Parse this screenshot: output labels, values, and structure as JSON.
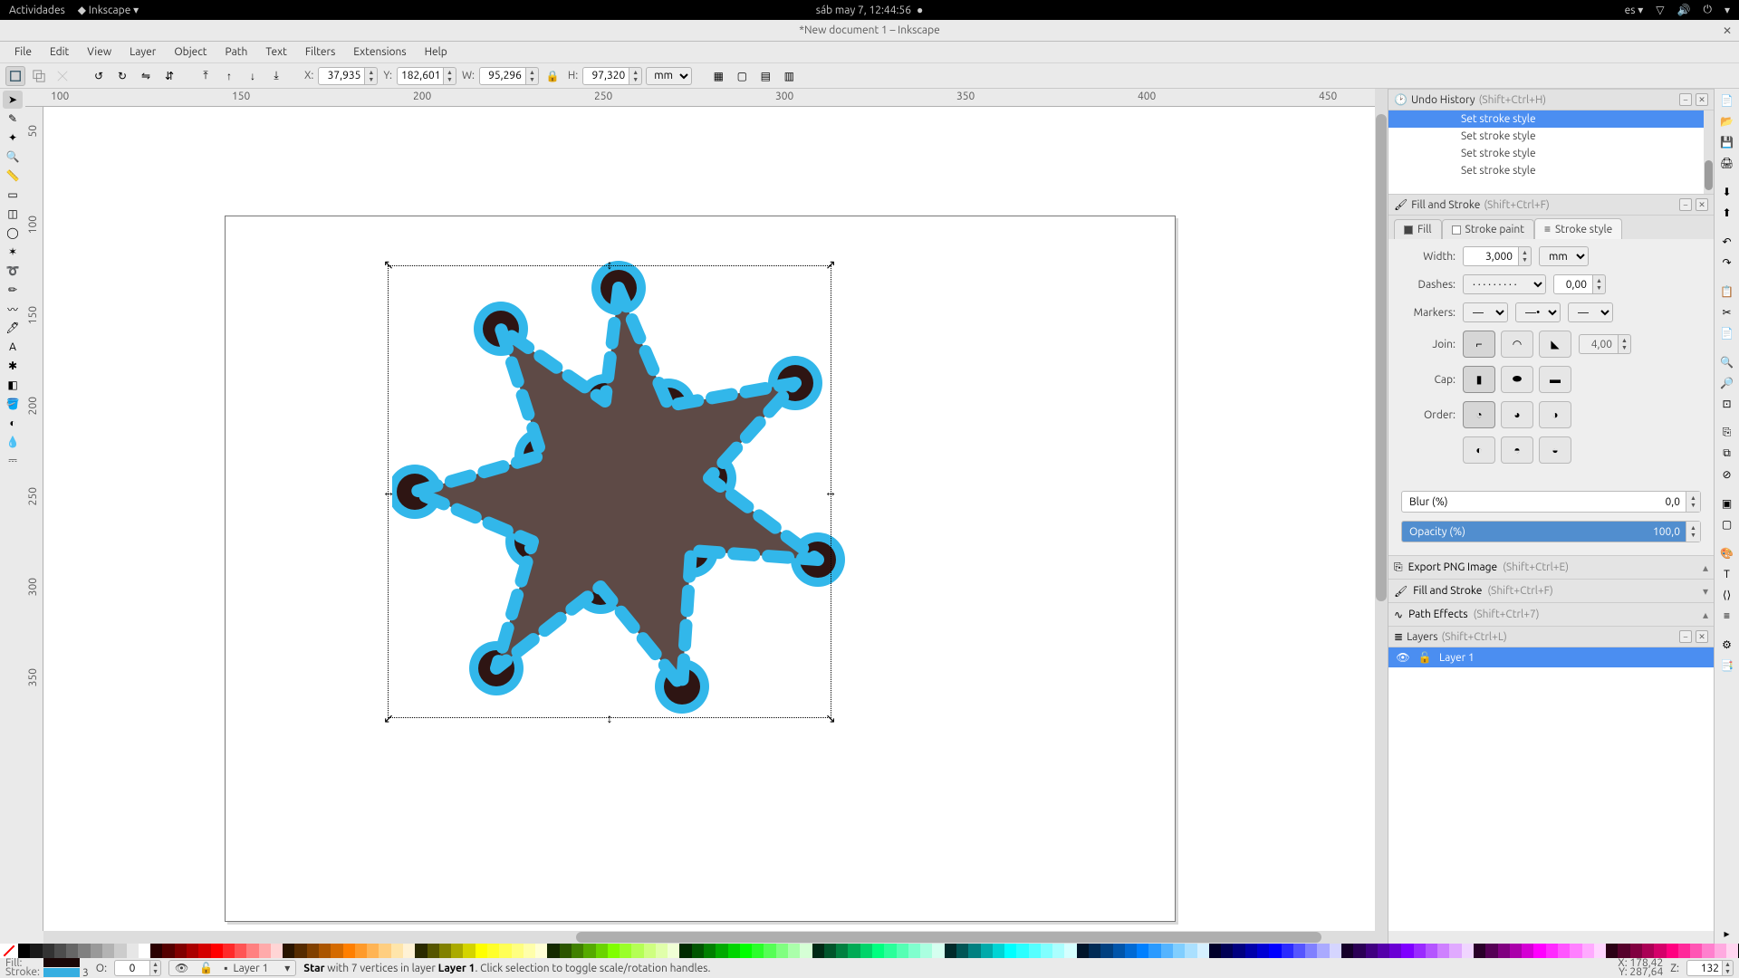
{
  "gnome": {
    "activities": "Actividades",
    "app_menu": "Inkscape",
    "clock": "sáb may  7, 12:44:56",
    "lang_indicator": "es"
  },
  "window": {
    "title": "*New document 1 – Inkscape"
  },
  "menu": [
    "File",
    "Edit",
    "View",
    "Layer",
    "Object",
    "Path",
    "Text",
    "Filters",
    "Extensions",
    "Help"
  ],
  "tooloptions": {
    "x_label": "X:",
    "x": "37,935",
    "y_label": "Y:",
    "y": "182,601",
    "w_label": "W:",
    "w": "95,296",
    "h_label": "H:",
    "h": "97,320",
    "unit": "mm"
  },
  "ruler_h": [
    [
      "100",
      0
    ],
    [
      "150",
      200
    ],
    [
      "200",
      400
    ],
    [
      "250",
      600
    ],
    [
      "300",
      800
    ],
    [
      "350",
      1000
    ],
    [
      "400",
      1200
    ],
    [
      "450",
      1400
    ]
  ],
  "ruler_v": [
    [
      "50",
      20
    ],
    [
      "100",
      120
    ],
    [
      "150",
      220
    ],
    [
      "200",
      320
    ],
    [
      "250",
      420
    ],
    [
      "300",
      520
    ],
    [
      "350",
      620
    ]
  ],
  "undo": {
    "panel_title": "Undo History",
    "shortcut": "(Shift+Ctrl+H)",
    "rows": [
      "Set stroke style",
      "Set stroke style",
      "Set stroke style",
      "Set stroke style"
    ],
    "selected_index": 3
  },
  "fillstroke": {
    "panel_title": "Fill and Stroke",
    "shortcut": "(Shift+Ctrl+F)",
    "tabs": {
      "fill": "Fill",
      "paint": "Stroke paint",
      "style": "Stroke style"
    },
    "width_label": "Width:",
    "width": "3,000",
    "width_unit": "mm",
    "dashes_label": "Dashes:",
    "dashes_offset": "0,00",
    "markers_label": "Markers:",
    "join_label": "Join:",
    "join_miter": "4,00",
    "cap_label": "Cap:",
    "order_label": "Order:",
    "blur_label": "Blur (%)",
    "blur": "0,0",
    "opacity_label": "Opacity (%)",
    "opacity": "100,0"
  },
  "collapsed_panels": {
    "export": {
      "title": "Export PNG Image",
      "shortcut": "(Shift+Ctrl+E)"
    },
    "fill2": {
      "title": "Fill and Stroke",
      "shortcut": "(Shift+Ctrl+F)"
    },
    "lpe": {
      "title": "Path Effects",
      "shortcut": "(Shift+Ctrl+7)"
    }
  },
  "layers": {
    "panel_title": "Layers",
    "shortcut": "(Shift+Ctrl+L)",
    "items": [
      {
        "name": "Layer 1"
      }
    ]
  },
  "palette": [
    "#000",
    "#1a1a1a",
    "#333",
    "#4d4d4d",
    "#666",
    "#808080",
    "#999",
    "#b3b3b3",
    "#ccc",
    "#e6e6e6",
    "#fff",
    "#2a0000",
    "#550000",
    "#800000",
    "#aa0000",
    "#d40000",
    "#ff0000",
    "#ff2a2a",
    "#ff5555",
    "#ff8080",
    "#ffaaaa",
    "#ffd5d5",
    "#2a1500",
    "#552b00",
    "#804000",
    "#aa5500",
    "#d46a00",
    "#ff7f00",
    "#ff9a2a",
    "#ffb455",
    "#ffce80",
    "#ffe5aa",
    "#fff2d5",
    "#2a2a00",
    "#555500",
    "#808000",
    "#aaaa00",
    "#d4d400",
    "#ffff00",
    "#ffff2a",
    "#ffff55",
    "#ffff80",
    "#ffffaa",
    "#ffffd5",
    "#152a00",
    "#2b5500",
    "#408000",
    "#55aa00",
    "#6ad400",
    "#80ff00",
    "#9aff2a",
    "#b4ff55",
    "#ceff80",
    "#e0ffaa",
    "#f0ffd5",
    "#002a00",
    "#005500",
    "#008000",
    "#00aa00",
    "#00d400",
    "#00ff00",
    "#2aff2a",
    "#55ff55",
    "#80ff80",
    "#aaffaa",
    "#d5ffd5",
    "#002a15",
    "#00552b",
    "#008040",
    "#00aa55",
    "#00d46a",
    "#00ff80",
    "#2aff9a",
    "#55ffb4",
    "#80ffce",
    "#aaffe0",
    "#d5fff0",
    "#002a2a",
    "#005555",
    "#008080",
    "#00aaaa",
    "#00d4d4",
    "#00ffff",
    "#2affff",
    "#55ffff",
    "#80ffff",
    "#aaffff",
    "#d5ffff",
    "#00152a",
    "#002b55",
    "#004080",
    "#0055aa",
    "#006ad4",
    "#0080ff",
    "#2a9aff",
    "#55b4ff",
    "#80ceff",
    "#aae0ff",
    "#d5f0ff",
    "#00002a",
    "#000055",
    "#000080",
    "#0000aa",
    "#0000d4",
    "#0000ff",
    "#2a2aff",
    "#5555ff",
    "#8080ff",
    "#aaaaff",
    "#d5d5ff",
    "#15002a",
    "#2b0055",
    "#400080",
    "#5500aa",
    "#6a00d4",
    "#7f00ff",
    "#9a2aff",
    "#b455ff",
    "#ce80ff",
    "#e0aaff",
    "#f0d5ff",
    "#2a002a",
    "#550055",
    "#800080",
    "#aa00aa",
    "#d400d4",
    "#ff00ff",
    "#ff2aff",
    "#ff55ff",
    "#ff80ff",
    "#ffaaff",
    "#ffd5ff",
    "#2a0015",
    "#55002b",
    "#800040",
    "#aa0055",
    "#d4006a",
    "#ff0080",
    "#ff2a9a",
    "#ff55b4",
    "#ff80ce",
    "#ffaae0",
    "#ffd5f0"
  ],
  "status": {
    "fill_label": "Fill:",
    "stroke_label": "Stroke:",
    "stroke_num": "3",
    "o_label": "O:",
    "o": "0",
    "layer": "Layer 1",
    "msg_obj": "Star",
    "msg_mid": " with 7 vertices in layer ",
    "msg_layer": "Layer 1",
    "msg_tail": ". Click selection to toggle scale/rotation handles.",
    "coord_x_label": "X:",
    "coord_x": "178,42",
    "coord_y_label": "Y:",
    "coord_y": "287,64",
    "z_label": "Z:",
    "zoom": "132"
  }
}
